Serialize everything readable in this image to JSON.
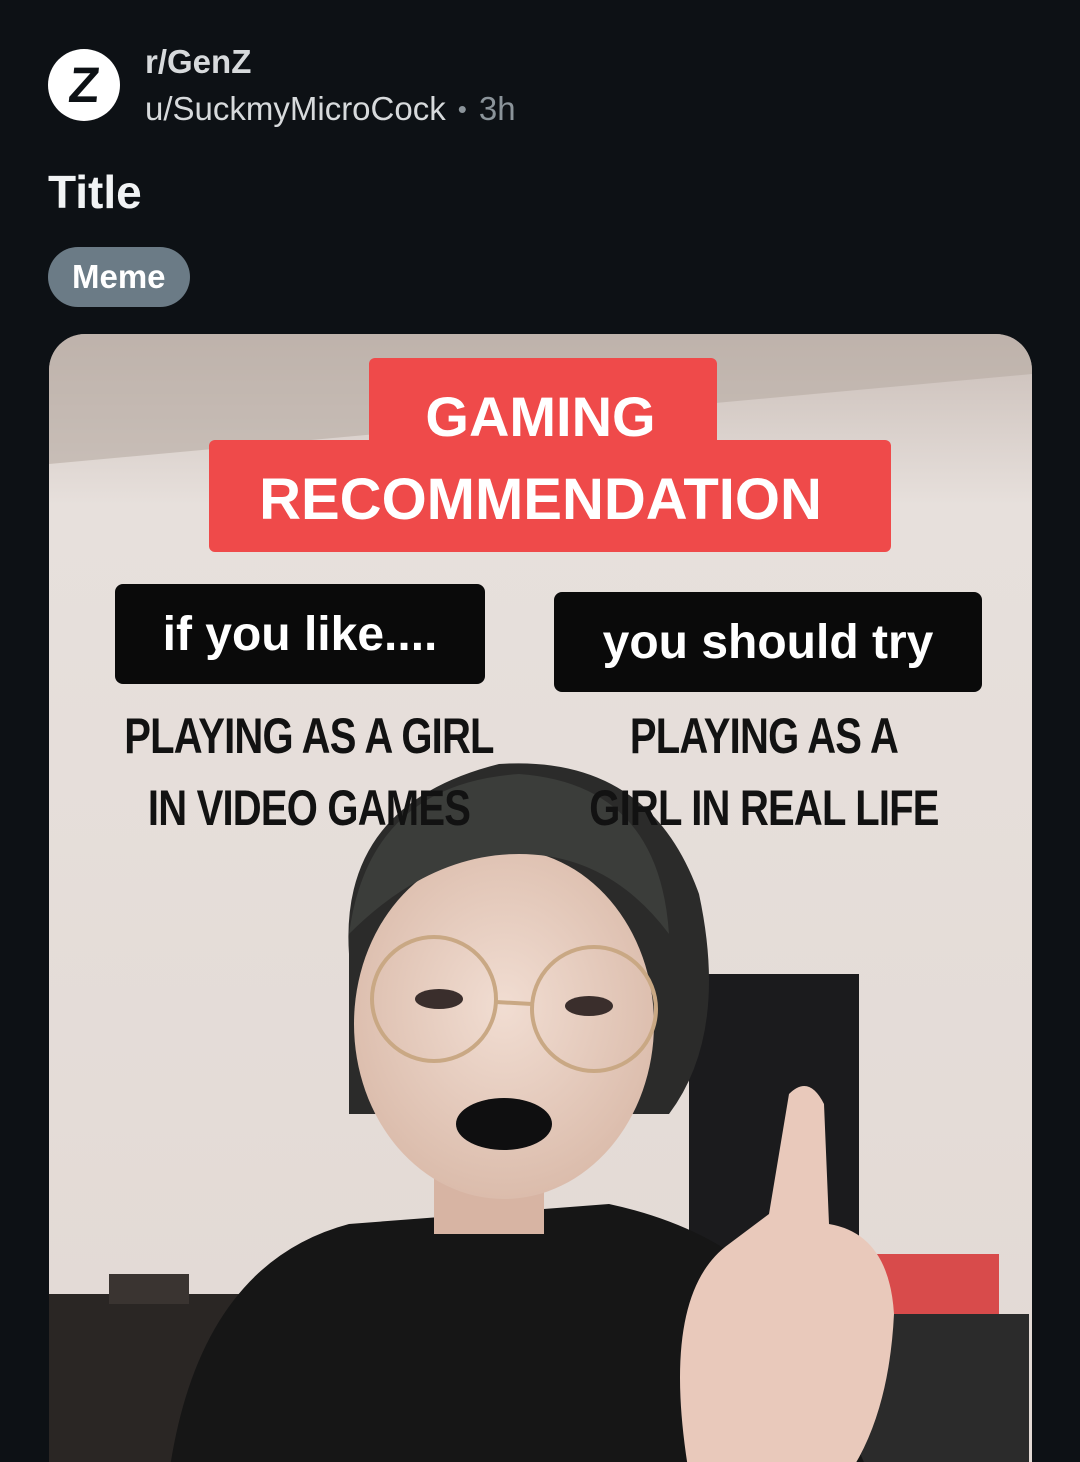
{
  "post": {
    "avatar_letter": "Z",
    "subreddit": "r/GenZ",
    "username": "u/SuckmyMicroCock",
    "separator": "•",
    "age": "3h",
    "title": "Title",
    "flair": "Meme"
  },
  "meme": {
    "header_line1": "GAMING",
    "header_line2": "RECOMMENDATION",
    "left_label": "if you like....",
    "right_label": "you should try",
    "left_caption_line1": "PLAYING AS A GIRL",
    "left_caption_line2": "IN VIDEO GAMES",
    "right_caption_line1": "PLAYING AS A",
    "right_caption_line2": "GIRL IN REAL LIFE"
  },
  "colors": {
    "background": "#0d1115",
    "flair": "#6b7b86",
    "red_banner": "#ef4a4a"
  }
}
